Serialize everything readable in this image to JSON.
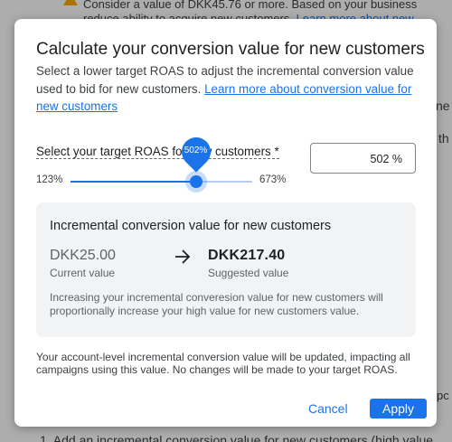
{
  "background": {
    "warning_line1": "Consider a value of DKK45.76 or more. Based on your business",
    "warning_line2": "reduce ability to acquire new customers. ",
    "warning_link": "Learn more about new",
    "side_text_1": "ne",
    "side_text_2": "th",
    "side_text_3": "pc",
    "bottom_text": "1. Add an incremental conversion value for new customers (high value"
  },
  "dialog": {
    "title": "Calculate your conversion value for new customers",
    "description": "Select a lower target ROAS to adjust the incremental conversion value used to bid for new customers. ",
    "description_link": "Learn more about conversion value for new customers",
    "target_label": "Select your target ROAS for new customers *",
    "target_value": "502 %",
    "slider": {
      "min_label": "123%",
      "max_label": "673%",
      "value_label": "502%",
      "min": 123,
      "max": 673,
      "value": 502
    },
    "card": {
      "title": "Incremental conversion value for new customers",
      "current_value": "DKK25.00",
      "current_label": "Current value",
      "suggested_value": "DKK217.40",
      "suggested_label": "Suggested value",
      "note": "Increasing your incremental converesion value for new customers will proportionally increase your high value for new customers value."
    },
    "footer_note": "Your account-level incremental conversion value will be updated, impacting all campaigns using this value. No changes will be made to your target ROAS.",
    "cancel_label": "Cancel",
    "apply_label": "Apply"
  },
  "colors": {
    "accent": "#1a73e8",
    "card_bg": "#f1f3f4",
    "warning": "#f9ab00"
  },
  "icons": [
    "warning-icon",
    "arrow-right-icon"
  ]
}
